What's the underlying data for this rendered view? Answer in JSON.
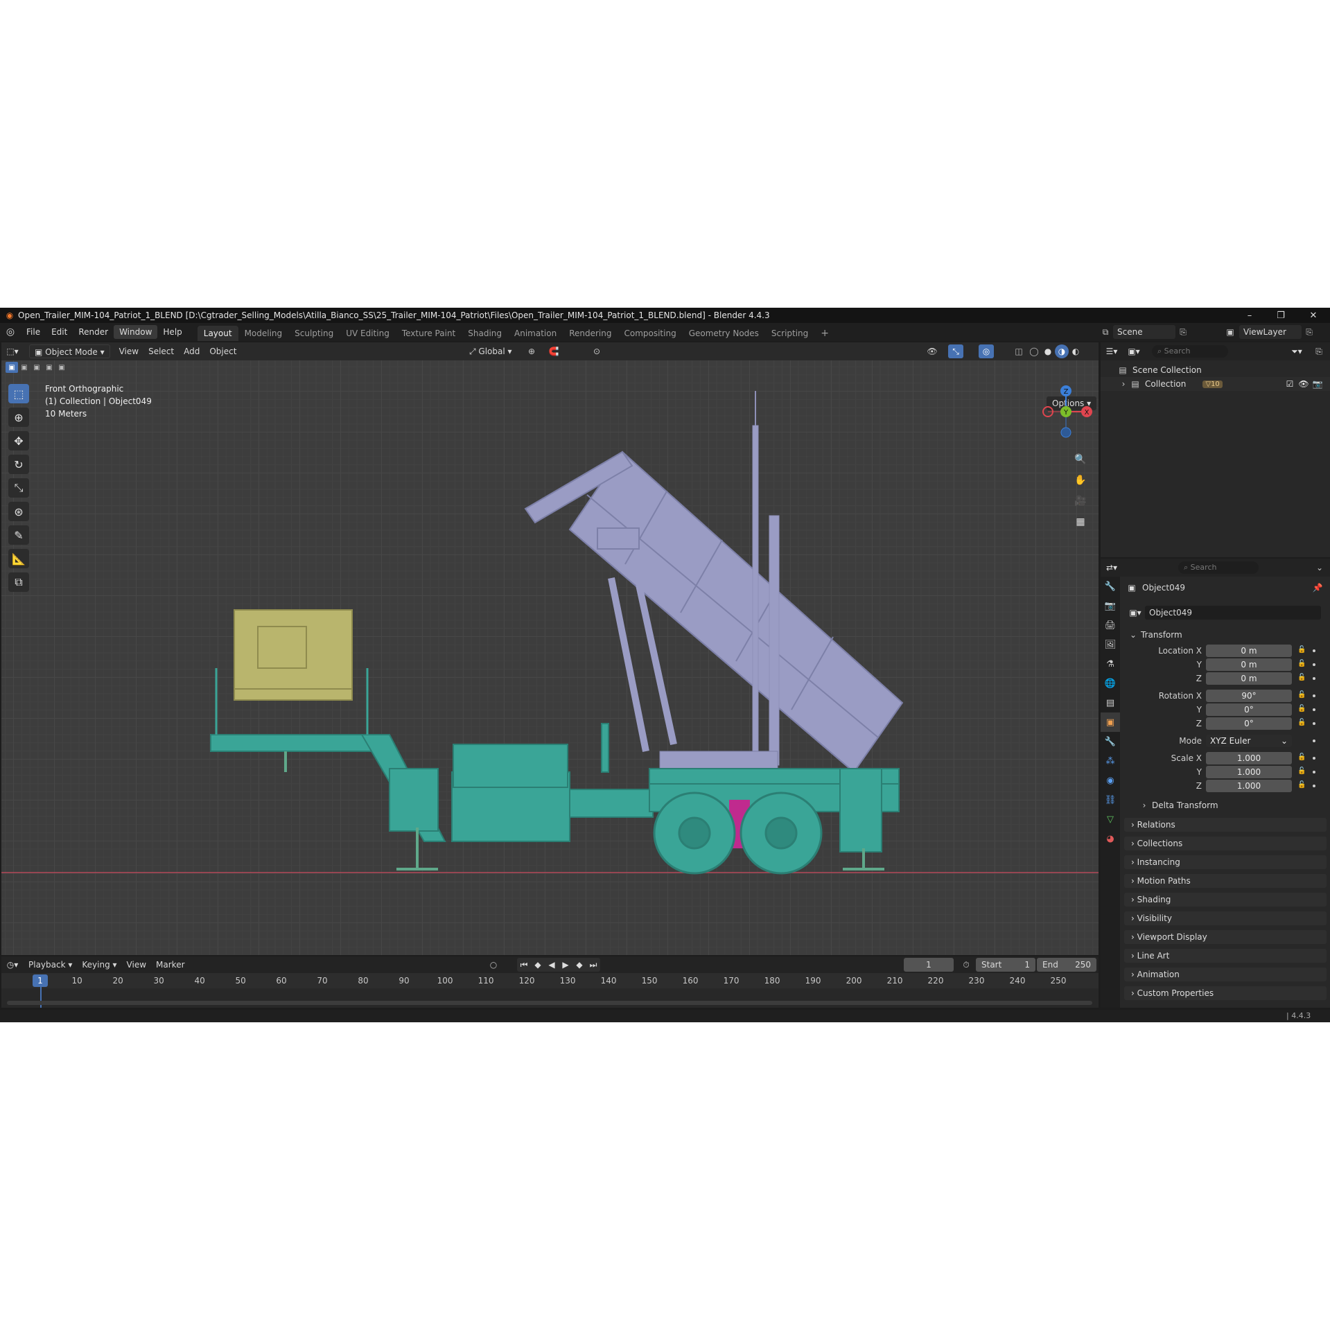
{
  "window": {
    "title": "Open_Trailer_MIM-104_Patriot_1_BLEND [D:\\Cgtrader_Selling_Models\\Atilla_Bianco_SS\\25_Trailer_MIM-104_Patriot\\Files\\Open_Trailer_MIM-104_Patriot_1_BLEND.blend] - Blender 4.4.3",
    "minimize": "–",
    "maximize": "❐",
    "close": "✕"
  },
  "menus": [
    "File",
    "Edit",
    "Render",
    "Window",
    "Help"
  ],
  "workspaces": [
    "Layout",
    "Modeling",
    "Sculpting",
    "UV Editing",
    "Texture Paint",
    "Shading",
    "Animation",
    "Rendering",
    "Compositing",
    "Geometry Nodes",
    "Scripting"
  ],
  "add_workspace": "+",
  "scene": {
    "label": "Scene",
    "view_layer": "ViewLayer"
  },
  "viewport": {
    "mode": "Object Mode",
    "menus": [
      "View",
      "Select",
      "Add",
      "Object"
    ],
    "orientation": "Global",
    "options_label": "Options",
    "info": {
      "view_name": "Front Orthographic",
      "collection": "(1) Collection | Object049",
      "scale": "10 Meters"
    },
    "gizmo": {
      "z": "Z",
      "y": "Y",
      "x": "X"
    }
  },
  "timeline": {
    "menus": [
      "Playback",
      "Keying",
      "View",
      "Marker"
    ],
    "current_frame": "1",
    "start_label": "Start",
    "start": "1",
    "end_label": "End",
    "end": "250",
    "ruler": [
      "10",
      "20",
      "30",
      "40",
      "50",
      "60",
      "70",
      "80",
      "90",
      "100",
      "110",
      "120",
      "130",
      "140",
      "150",
      "160",
      "170",
      "180",
      "190",
      "200",
      "210",
      "220",
      "230",
      "240",
      "250"
    ]
  },
  "outliner": {
    "search_placeholder": "Search",
    "scene_collection": "Scene Collection",
    "collection": "Collection",
    "collection_badge": "10"
  },
  "properties": {
    "search_placeholder": "Search",
    "object_name": "Object049",
    "object_field": "Object049",
    "transform_label": "Transform",
    "location": {
      "label": "Location X",
      "x": "0 m",
      "y": "0 m",
      "z": "0 m"
    },
    "rotation": {
      "label": "Rotation X",
      "x": "90°",
      "y": "0°",
      "z": "0°"
    },
    "axis_y": "Y",
    "axis_z": "Z",
    "mode_label": "Mode",
    "mode": "XYZ Euler",
    "scale": {
      "label": "Scale X",
      "x": "1.000",
      "y": "1.000",
      "z": "1.000"
    },
    "delta_transform": "Delta Transform",
    "panels": [
      "Relations",
      "Collections",
      "Instancing",
      "Motion Paths",
      "Shading",
      "Visibility",
      "Viewport Display",
      "Line Art",
      "Animation",
      "Custom Properties"
    ]
  },
  "status": {
    "version": "4.4.3"
  },
  "colors": {
    "accent": "#4772b3",
    "x_axis": "#e0454f",
    "y_axis": "#7cbd2a",
    "z_axis": "#3b7fd9",
    "missile_box": "#9a9cc4",
    "chassis": "#3aa597",
    "generator": "#b9b56d"
  }
}
